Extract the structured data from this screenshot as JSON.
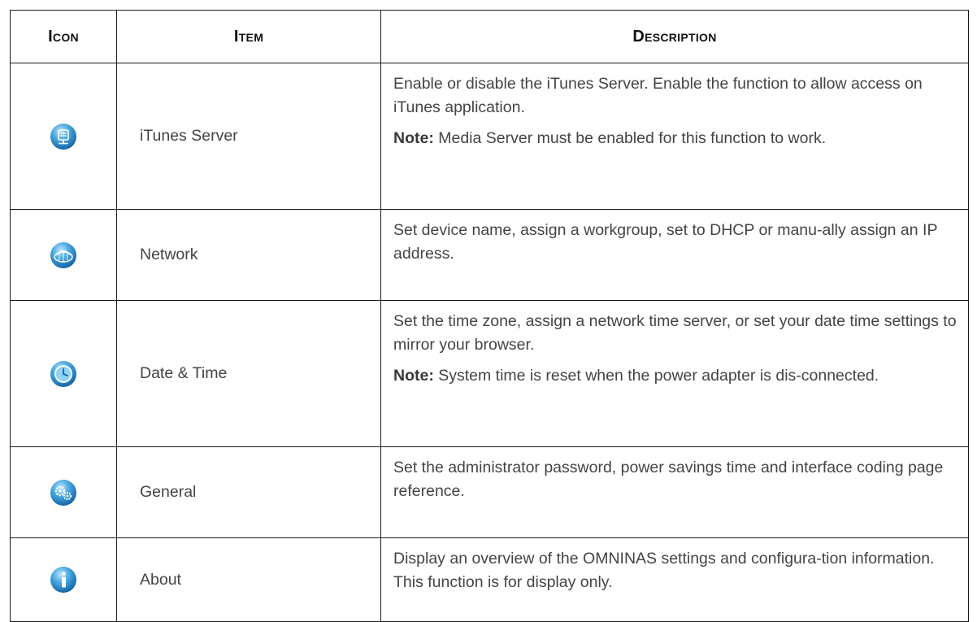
{
  "table": {
    "headers": {
      "icon": "Icon",
      "item": "Item",
      "description": "Description"
    },
    "rows": [
      {
        "icon": "itunes-server-icon",
        "item": "iTunes Server",
        "description": "Enable or disable the iTunes Server. Enable the function to allow access on iTunes application.",
        "note_label": "Note:",
        "note_text": " Media Server must be enabled for this function to work."
      },
      {
        "icon": "network-icon",
        "item": "Network",
        "description": "Set device name, assign a workgroup, set to DHCP or manu-ally assign an IP address."
      },
      {
        "icon": "clock-icon",
        "item": "Date & Time",
        "description": "Set the time zone, assign a network time server, or set your date time settings to mirror your browser.",
        "note_label": "Note:",
        "note_text": " System time is reset when the power adapter is dis-connected."
      },
      {
        "icon": "gears-icon",
        "item": "General",
        "description": "Set the administrator password, power savings time and interface coding page reference."
      },
      {
        "icon": "info-icon",
        "item": "About",
        "description": "Display an overview of the OMNINAS settings and configura-tion information. This function is for display only."
      }
    ]
  },
  "colors": {
    "border": "#1a1a1a",
    "text": "#444444",
    "icon_blue": "#2f8fcf"
  }
}
